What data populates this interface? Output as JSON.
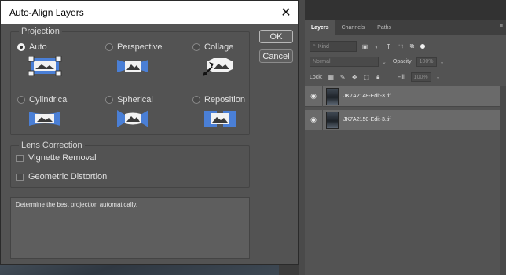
{
  "dialog": {
    "title": "Auto-Align Layers",
    "projection_label": "Projection",
    "projections": [
      {
        "label": "Auto",
        "selected": true
      },
      {
        "label": "Perspective",
        "selected": false
      },
      {
        "label": "Collage",
        "selected": false
      },
      {
        "label": "Cylindrical",
        "selected": false
      },
      {
        "label": "Spherical",
        "selected": false
      },
      {
        "label": "Reposition",
        "selected": false
      }
    ],
    "lens_label": "Lens Correction",
    "lens_options": [
      {
        "label": "Vignette Removal",
        "checked": false
      },
      {
        "label": "Geometric Distortion",
        "checked": false
      }
    ],
    "description": "Determine the best projection automatically.",
    "ok_label": "OK",
    "cancel_label": "Cancel",
    "accent_color": "#4a7fd6"
  },
  "layers_panel": {
    "tabs": [
      "Layers",
      "Channels",
      "Paths"
    ],
    "active_tab": "Layers",
    "filter_placeholder": "Kind",
    "blend_mode": "Normal",
    "opacity_label": "Opacity:",
    "opacity_value": "100%",
    "lock_label": "Lock:",
    "fill_label": "Fill:",
    "fill_value": "100%",
    "layers": [
      {
        "name": "JK7A2148-Edit-3.tif",
        "visible": true
      },
      {
        "name": "JK7A2150-Edit-3.tif",
        "visible": true
      }
    ]
  }
}
